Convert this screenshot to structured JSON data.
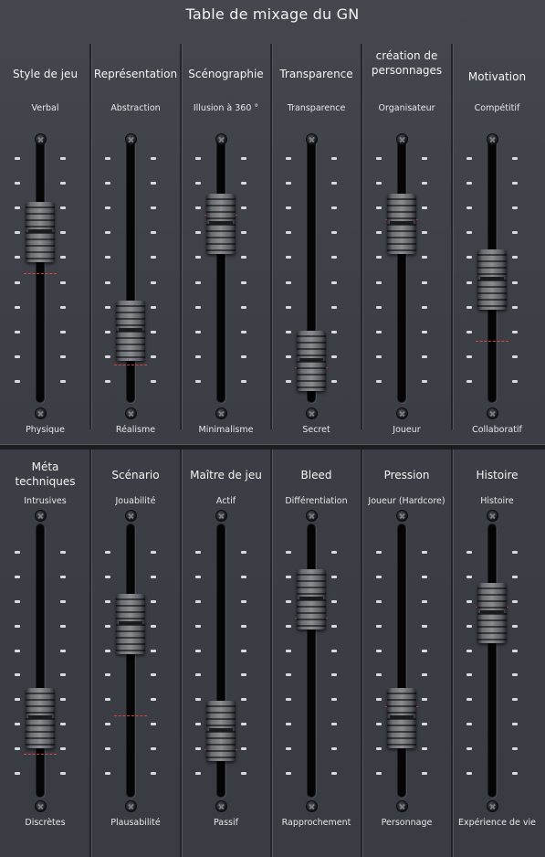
{
  "title": "Table de mixage du GN",
  "rows": [
    {
      "channels": [
        {
          "name": "Style de jeu",
          "top_label": "Verbal",
          "bottom_label": "Physique"
        },
        {
          "name": "Représentation",
          "top_label": "Abstraction",
          "bottom_label": "Réalisme"
        },
        {
          "name": "Scénographie",
          "top_label": "Illusion à 360 °",
          "bottom_label": "Minimalisme"
        },
        {
          "name": "Transparence",
          "top_label": "Transparence",
          "bottom_label": "Secret"
        },
        {
          "name": "création de personnages",
          "top_label": "Organisateur",
          "bottom_label": "Joueur"
        },
        {
          "name": "Motivation",
          "top_label": "Compétitif",
          "bottom_label": "Collaboratif"
        }
      ]
    },
    {
      "channels": [
        {
          "name": "Méta techniques",
          "top_label": "Intrusives",
          "bottom_label": "Discrètes"
        },
        {
          "name": "Scénario",
          "top_label": "Jouabilité",
          "bottom_label": "Plausabilité"
        },
        {
          "name": "Maître de jeu",
          "top_label": "Actif",
          "bottom_label": "Passif"
        },
        {
          "name": "Bleed",
          "top_label": "Différentiation",
          "bottom_label": "Rapprochement"
        },
        {
          "name": "Pression",
          "top_label": "Joueur (Hardcore)",
          "bottom_label": "Personnage"
        },
        {
          "name": "Histoire",
          "top_label": "Histoire",
          "bottom_label": "Expérience de vie"
        }
      ]
    }
  ],
  "fader_levels": {
    "note": "",
    "row1": [
      0.79,
      0.33,
      0.83,
      0.19,
      0.83,
      0.57
    ],
    "row2": [
      0.35,
      0.77,
      0.29,
      0.88,
      0.35,
      0.82
    ]
  },
  "red_markers": {
    "row1": [
      0.6,
      0.17,
      0.87,
      0.16,
      0.85,
      0.28
    ],
    "row2": [
      0.19,
      0.36,
      0.21,
      0.8,
      0.4,
      0.85
    ]
  },
  "colors": {
    "panel": "#3c3f46",
    "slot": "#050506",
    "tick": "#d9dadd",
    "marker": "#d9463f"
  }
}
